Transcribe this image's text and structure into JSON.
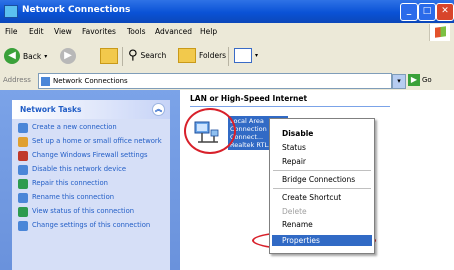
{
  "window": {
    "title": "Network Connections"
  },
  "menu": [
    "File",
    "Edit",
    "View",
    "Favorites",
    "Tools",
    "Advanced",
    "Help"
  ],
  "toolbar": {
    "back": "Back",
    "search": "Search",
    "folders": "Folders"
  },
  "address": {
    "label": "Address",
    "value": "Network Connections",
    "go": "Go"
  },
  "tasks": {
    "header": "Network Tasks",
    "items": [
      {
        "label": "Create a new connection",
        "icon": "new-connection-icon"
      },
      {
        "label": "Set up a home or small office network",
        "icon": "home-network-icon"
      },
      {
        "label": "Change Windows Firewall settings",
        "icon": "firewall-icon"
      },
      {
        "label": "Disable this network device",
        "icon": "disable-device-icon"
      },
      {
        "label": "Repair this connection",
        "icon": "repair-icon"
      },
      {
        "label": "Rename this connection",
        "icon": "rename-icon"
      },
      {
        "label": "View status of this connection",
        "icon": "status-icon"
      },
      {
        "label": "Change settings of this connection",
        "icon": "settings-icon"
      }
    ]
  },
  "content": {
    "section_title": "LAN or High-Speed Internet",
    "connection": {
      "line1": "Local Area Connection",
      "line2": "Connect...",
      "line3": "Realtek RTL..."
    }
  },
  "context_menu": {
    "disable": "Disable",
    "status": "Status",
    "repair": "Repair",
    "bridge": "Bridge Connections",
    "shortcut": "Create Shortcut",
    "delete": "Delete",
    "rename": "Rename",
    "properties": "Properties"
  },
  "colors": {
    "title_bar": "#0a52d6",
    "highlight": "#316ac5",
    "annotation": "#d8202a",
    "task_pane": "#d6dff7"
  }
}
